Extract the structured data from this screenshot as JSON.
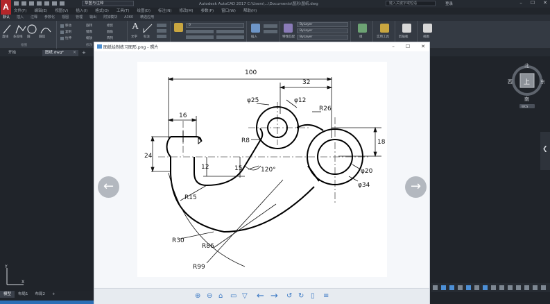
{
  "app": {
    "logo": "A",
    "workspace": "草图与注释",
    "window_title": "Autodesk AutoCAD 2017    C:\\Users\\...\\Documents\\图形\\图纸.dwg",
    "search_placeholder": "键入关键字或短语",
    "user": "登录"
  },
  "menu": [
    "文件(F)",
    "编辑(E)",
    "视图(V)",
    "插入(I)",
    "格式(O)",
    "工具(T)",
    "绘图(D)",
    "标注(N)",
    "修改(M)",
    "参数(P)",
    "窗口(W)",
    "帮助(H)"
  ],
  "ribbon_tabs": [
    "默认",
    "插入",
    "注释",
    "参数化",
    "视图",
    "管理",
    "输出",
    "附加模块",
    "A360",
    "精选应用"
  ],
  "ribbon": {
    "draw_labels": [
      "直线",
      "多段线",
      "圆",
      "圆弧"
    ],
    "modify_labels": [
      "移动",
      "旋转",
      "修剪",
      "复制",
      "镜像",
      "圆角",
      "拉伸",
      "缩放",
      "阵列"
    ],
    "annotation_labels": [
      "文字",
      "标注"
    ],
    "layer_combo": "0",
    "bylayer_1": "ByLayer",
    "bylayer_2": "ByLayer",
    "bylayer_3": "ByLayer",
    "insert_label": "插入",
    "match_label": "特性匹配",
    "group_label": "组",
    "utilities_label": "实用工具",
    "clipboard_label": "剪贴板",
    "view_label": "视图",
    "panel_titles": [
      "绘图",
      "修改",
      "注释",
      "图层",
      "块",
      "特性",
      "组",
      "实用工具",
      "剪贴板",
      "视图"
    ]
  },
  "file_tabs": {
    "start": "开始",
    "doc": "图纸.dwg*"
  },
  "model_tabs": [
    "模型",
    "布局1",
    "布局2"
  ],
  "viewcube": {
    "north": "北",
    "south": "南",
    "east": "东",
    "west": "西",
    "top": "上",
    "wcs": "WCS"
  },
  "viewer": {
    "title": "图纸绘制练习图形.png - 照片",
    "minimize": "–",
    "maximize": "☐",
    "close": "✕",
    "prev": "←",
    "next": "→"
  },
  "drawing": {
    "dims": {
      "d100": "100",
      "d32": "32",
      "d25": "φ25",
      "d12": "φ12",
      "r26": "R26",
      "d16": "16",
      "r8": "R8",
      "d24": "24",
      "d18": "18",
      "d12v": "12",
      "d15": "15",
      "a120": "120°",
      "d20": "φ20",
      "d34": "φ34",
      "r15": "R15",
      "r30": "R30",
      "r86": "R86",
      "r99": "R99"
    }
  },
  "colors": {
    "accent": "#2b6fb6",
    "logo": "#b3262a"
  }
}
